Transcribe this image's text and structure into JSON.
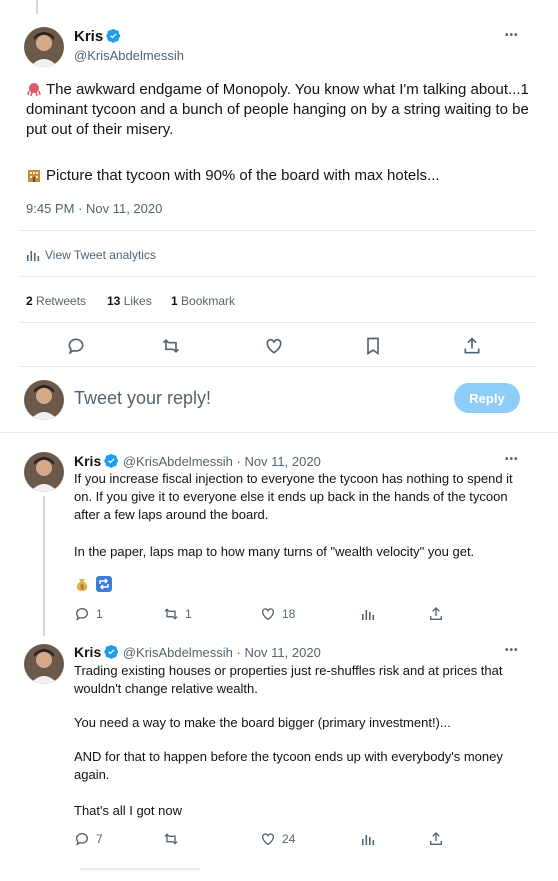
{
  "main_tweet": {
    "author_name": "Kris",
    "author_handle": "@KrisAbdelmessih",
    "more_label": "•••",
    "text_p1": "The awkward endgame of Monopoly. You know what I'm talking about...1 dominant tycoon and a bunch of people hanging on by a string waiting to be put out of their misery.",
    "text_p2": "Picture that tycoon with 90% of the board with max hotels...",
    "timestamp": "9:45 PM · Nov 11, 2020",
    "analytics_label": "View Tweet analytics",
    "stats": {
      "retweets_count": "2",
      "retweets_label": "Retweets",
      "likes_count": "13",
      "likes_label": "Likes",
      "bookmarks_count": "1",
      "bookmarks_label": "Bookmark"
    }
  },
  "composer": {
    "placeholder": "Tweet your reply!",
    "reply_button": "Reply"
  },
  "replies": [
    {
      "author_name": "Kris",
      "author_handle": "@KrisAbdelmessih",
      "date": "· Nov 11, 2020",
      "more_label": "•••",
      "text_p1": "If you increase fiscal injection to everyone the tycoon has nothing to spend it on. If you give it to everyone else it ends up back in the hands of the tycoon after a few laps around the board.",
      "text_p2": "In the paper, laps map to how many turns of \"wealth velocity\" you get.",
      "replies_count": "1",
      "retweets_count": "1",
      "likes_count": "18"
    },
    {
      "author_name": "Kris",
      "author_handle": "@KrisAbdelmessih",
      "date": "· Nov 11, 2020",
      "more_label": "•••",
      "text_p1": "Trading existing houses or properties just re-shuffles risk and at prices that wouldn't change relative wealth.",
      "text_p2": "You need a way to make the board bigger (primary investment!)...",
      "text_p3": "AND for that to happen before the tycoon ends up with everybody's money again.",
      "text_p4": "That's all I got now",
      "replies_count": "7",
      "likes_count": "24"
    }
  ],
  "colors": {
    "accent": "#1d9bf0",
    "reply_button": "#8ecdf8",
    "muted": "#536471",
    "divider": "#e6ecf0"
  },
  "icons": [
    "verified-badge-icon",
    "reply-icon",
    "retweet-icon",
    "like-icon",
    "bookmark-icon",
    "share-icon",
    "analytics-icon"
  ]
}
